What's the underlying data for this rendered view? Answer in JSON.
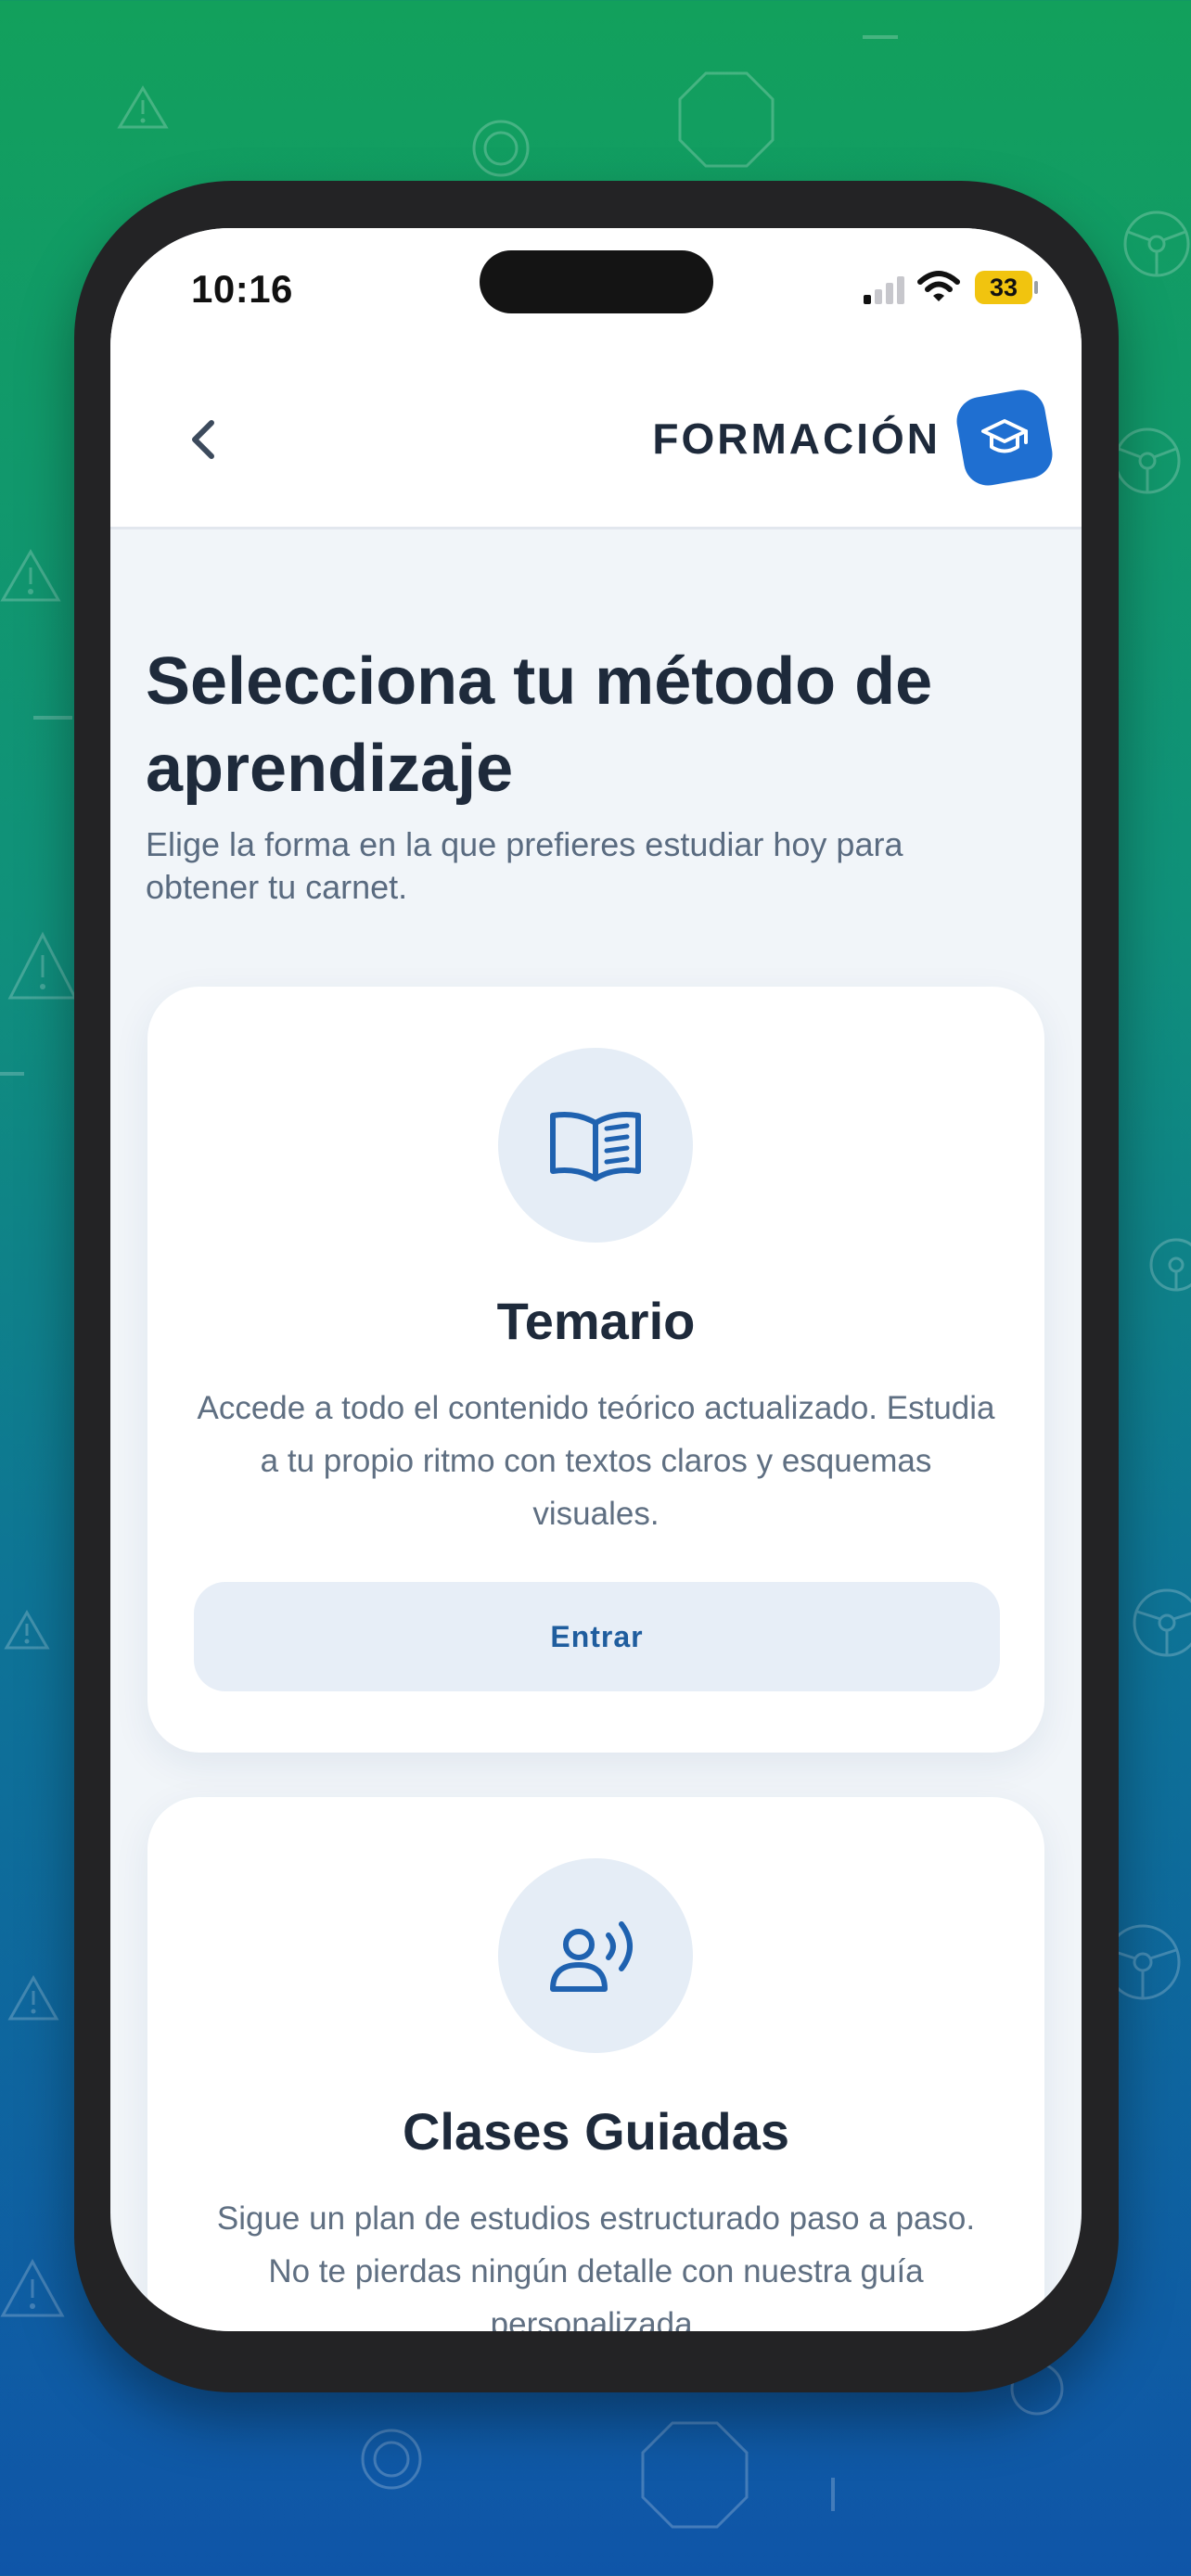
{
  "background_colors": {
    "top": "#12a05c",
    "bottom": "#0f55a8"
  },
  "status_bar": {
    "time": "10:16",
    "battery_level": "33",
    "icons": [
      "signal-icon",
      "wifi-icon",
      "battery-icon"
    ]
  },
  "header": {
    "back_icon": "chevron-left-icon",
    "brand_title": "FORMACIÓN",
    "brand_icon": "graduation-cap-icon",
    "accent_color": "#1f6fd1"
  },
  "page": {
    "title": "Selecciona tu método de aprendizaje",
    "subtitle": "Elige la forma en la que prefieres estudiar hoy para obtener tu carnet."
  },
  "cards": [
    {
      "icon": "open-book-icon",
      "title": "Temario",
      "description": "Accede a todo el contenido teórico actualizado. Estudia a tu propio ritmo con textos claros y esquemas visuales.",
      "button_label": "Entrar"
    },
    {
      "icon": "speaking-person-icon",
      "title": "Clases Guiadas",
      "description": "Sigue un plan de estudios estructurado paso a paso. No te pierdas ningún detalle con nuestra guía personalizada."
    }
  ]
}
